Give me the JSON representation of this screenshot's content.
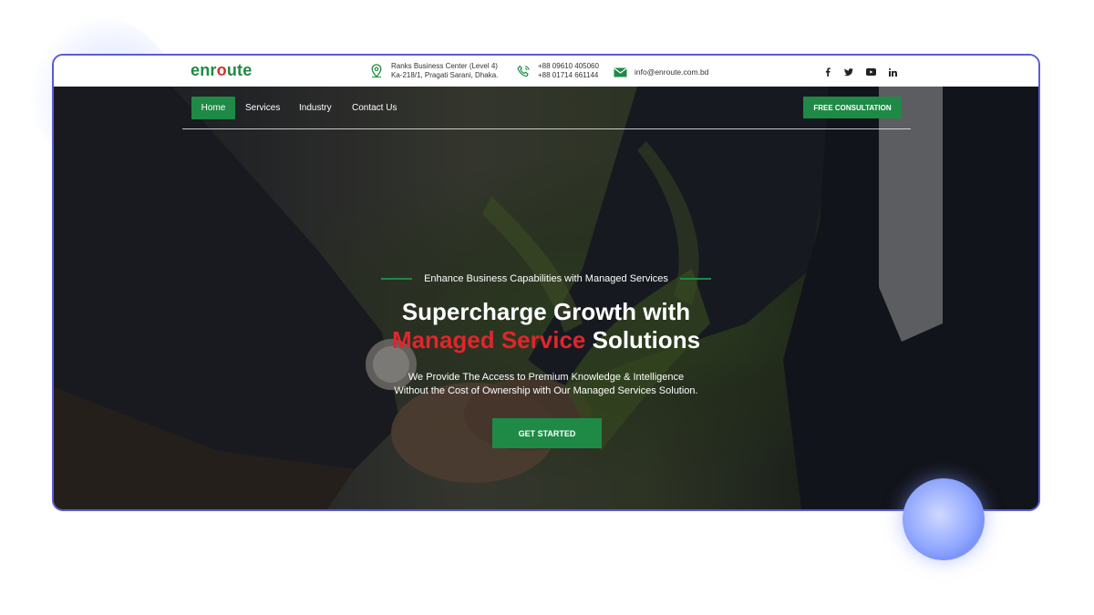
{
  "brand": {
    "logo_pre": "enr",
    "logo_o": "o",
    "logo_post": "ute"
  },
  "topbar": {
    "address_line1": "Ranks Business Center (Level 4)",
    "address_line2": "Ka-218/1, Pragati Sarani, Dhaka.",
    "phone_line1": "+88 09610 405060",
    "phone_line2": "+88 01714 661144",
    "email": "info@enroute.com.bd",
    "social": [
      "facebook-icon",
      "twitter-icon",
      "youtube-icon",
      "linkedin-icon"
    ]
  },
  "nav": {
    "items": [
      {
        "label": "Home",
        "active": true
      },
      {
        "label": "Services"
      },
      {
        "label": "Industry"
      },
      {
        "label": "Contact Us"
      }
    ],
    "cta": "FREE CONSULTATION"
  },
  "hero": {
    "eyebrow": "Enhance Business Capabilities with Managed Services",
    "title_line1": "Supercharge Growth with",
    "title_highlight": "Managed Service",
    "title_end": " Solutions",
    "subtitle_line1": "We Provide The Access to Premium Knowledge & Intelligence",
    "subtitle_line2": "Without the Cost of Ownership with Our Managed Services Solution.",
    "cta": "GET STARTED"
  },
  "colors": {
    "brand_green": "#1e8a46",
    "accent_red": "#e0262b",
    "frame_border": "#5b5bd6"
  }
}
